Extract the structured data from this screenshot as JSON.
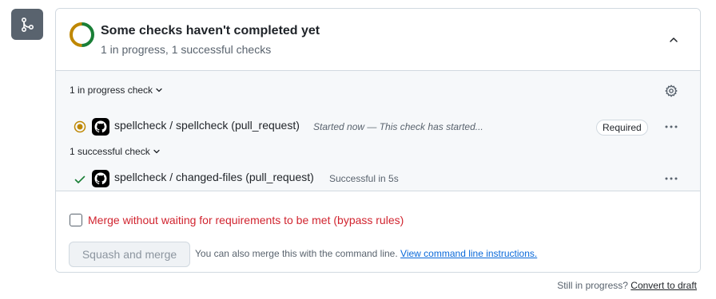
{
  "header": {
    "title": "Some checks haven't completed yet",
    "subtitle": "1 in progress, 1 successful checks"
  },
  "groups": {
    "in_progress": {
      "label": "1 in progress check",
      "checks": [
        {
          "name": "spellcheck / spellcheck (pull_request)",
          "description": "Started now — This check has started...",
          "status": "in-progress",
          "badge": "Required"
        }
      ]
    },
    "successful": {
      "label": "1 successful check",
      "checks": [
        {
          "name": "spellcheck / changed-files (pull_request)",
          "description": "Successful in 5s",
          "status": "success"
        }
      ]
    }
  },
  "merge": {
    "bypass_label": "Merge without waiting for requirements to be met (bypass rules)",
    "bypass_checked": false,
    "button_label": "Squash and merge",
    "hint_text": "You can also merge this with the command line.",
    "hint_link": "View command line instructions."
  },
  "footer": {
    "text": "Still in progress?",
    "link": "Convert to draft"
  },
  "colors": {
    "ring_in_progress": "#bf8700",
    "ring_success": "#1a7f37",
    "danger_text": "#d1242f",
    "link": "#0969da",
    "icon_box": "#59636e"
  },
  "icons": {
    "timeline": "git-merge-icon",
    "collapse": "chevron-up-icon",
    "settings": "gear-icon",
    "more": "kebab-horizontal-icon",
    "check": "check-icon",
    "in_progress": "dot-fill-icon",
    "app": "github-logo-icon"
  }
}
